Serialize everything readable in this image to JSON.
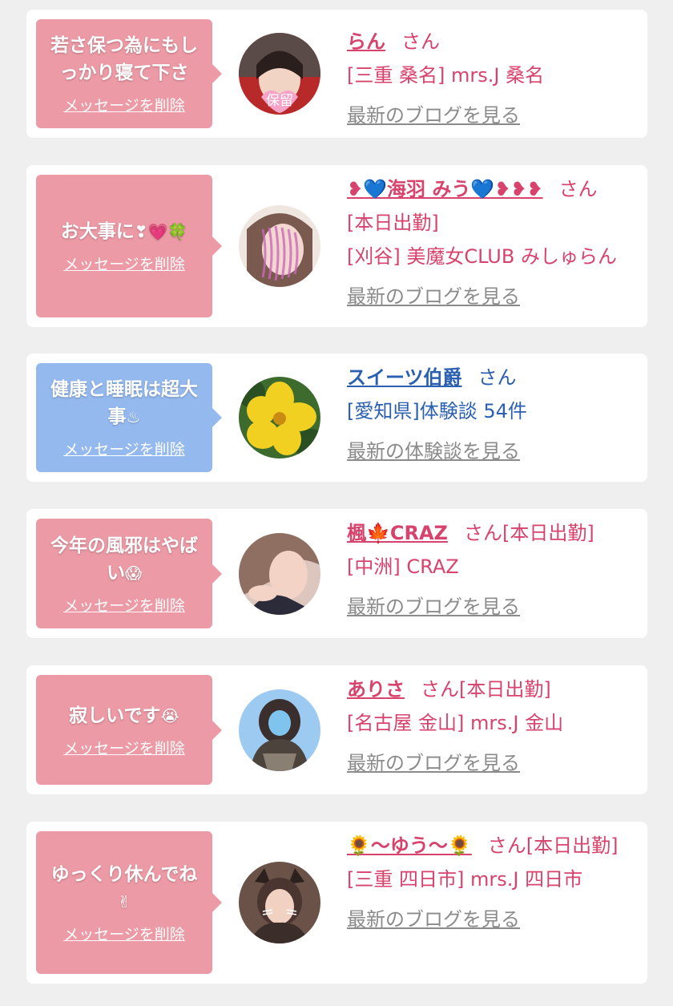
{
  "cards": [
    {
      "message": "若さ保つ為にもしっかり寝て下さ",
      "message_emoji": "",
      "delete_label": "メッセージを削除",
      "name": "らん",
      "san": "さん",
      "lines": [
        "[三重 桑名] mrs.J 桑名"
      ],
      "link": "最新のブログを見る",
      "avatar_text": "保留"
    },
    {
      "message": "お大事に",
      "message_emoji": "❣💗🍀",
      "delete_label": "メッセージを削除",
      "name": "❥💙海羽 みう💙❥❥❥",
      "san": "さん",
      "lines": [
        "[本日出勤]",
        "[刈谷] 美魔女CLUB みしゅらん"
      ],
      "link": "最新のブログを見る",
      "avatar_text": ""
    },
    {
      "message": "健康と睡眠は超大事",
      "message_emoji": "♨",
      "delete_label": "メッセージを削除",
      "name": "スイーツ伯爵",
      "san": "さん",
      "lines": [
        "[愛知県]体験談 54件"
      ],
      "link": "最新の体験談を見る",
      "avatar_text": ""
    },
    {
      "message": "今年の風邪はやばい",
      "message_emoji": "😱",
      "delete_label": "メッセージを削除",
      "name": "楓🍁CRAZ",
      "san": "さん[本日出勤]",
      "lines": [
        "[中洲] CRAZ"
      ],
      "link": "最新のブログを見る",
      "avatar_text": ""
    },
    {
      "message": "寂しいです",
      "message_emoji": "😭",
      "delete_label": "メッセージを削除",
      "name": "ありさ",
      "san": "さん[本日出勤]",
      "lines": [
        "[名古屋 金山] mrs.J 金山"
      ],
      "link": "最新のブログを見る",
      "avatar_text": ""
    },
    {
      "message": "ゆっくり休んでね",
      "message_emoji": "✌",
      "delete_label": "メッセージを削除",
      "name": "🌻〜ゆう〜🌻",
      "san": "さん[本日出勤]",
      "lines": [
        "[三重 四日市] mrs.J 四日市"
      ],
      "link": "最新のブログを見る",
      "avatar_text": ""
    }
  ],
  "colors": {
    "pink": "#ec9aa5",
    "blue": "#94b9ee",
    "name_pink": "#d8436d",
    "name_blue": "#2b5fb1",
    "link_gray": "#8b8b8b"
  }
}
